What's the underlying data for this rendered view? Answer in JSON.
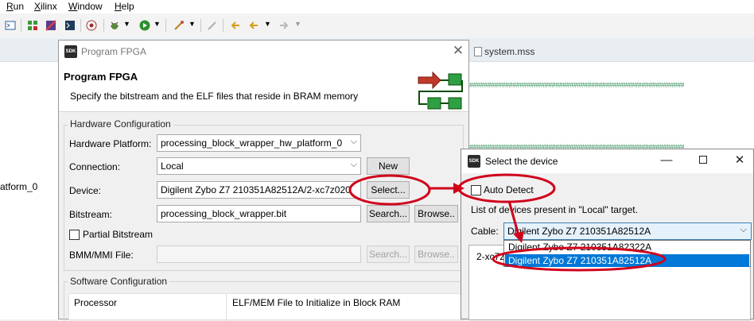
{
  "menubar": {
    "items": [
      "Run",
      "Xilinx",
      "Window",
      "Help"
    ],
    "underline": [
      "R",
      "X",
      "W",
      "H"
    ],
    "rest": [
      "un",
      "ilinx",
      "indow",
      "elp"
    ]
  },
  "ide": {
    "left_fragment": "atform_0",
    "editor_tab": "system.mss"
  },
  "dialog": {
    "title": "Program FPGA",
    "heading": "Program FPGA",
    "description": "Specify the bitstream and the ELF files that reside in BRAM memory",
    "hardware_group": "Hardware Configuration",
    "hardware_platform_label": "Hardware Platform:",
    "hardware_platform_value": "processing_block_wrapper_hw_platform_0",
    "connection_label": "Connection:",
    "connection_value": "Local",
    "new_button": "New",
    "device_label": "Device:",
    "device_value": "Digilent Zybo Z7 210351A82512A/2-xc7z020",
    "select_button": "Select...",
    "bitstream_label": "Bitstream:",
    "bitstream_value": "processing_block_wrapper.bit",
    "search_button": "Search...",
    "browse_button": "Browse..",
    "partial_bitstream_label": "Partial Bitstream",
    "bmm_label": "BMM/MMI File:",
    "bmm_search_button": "Search...",
    "bmm_browse_button": "Browse..",
    "software_group": "Software Configuration",
    "col_processor": "Processor",
    "col_elf": "ELF/MEM File to Initialize in Block RAM"
  },
  "device_dialog": {
    "title": "Select the device",
    "auto_detect_label": "Auto Detect",
    "list_caption": "List of devices present in \"Local\" target.",
    "cable_label": "Cable:",
    "cable_value": "Digilent Zybo Z7 210351A82512A",
    "options": [
      "Digilent Zybo Z7 210351A82322A",
      "Digilent Zybo Z7 210351A82512A"
    ],
    "list_item_fragment": "2-xc7z"
  },
  "colors": {
    "annotation_red": "#d0021b",
    "selection_blue": "#0078d7",
    "logo_green": "#2ea043"
  }
}
